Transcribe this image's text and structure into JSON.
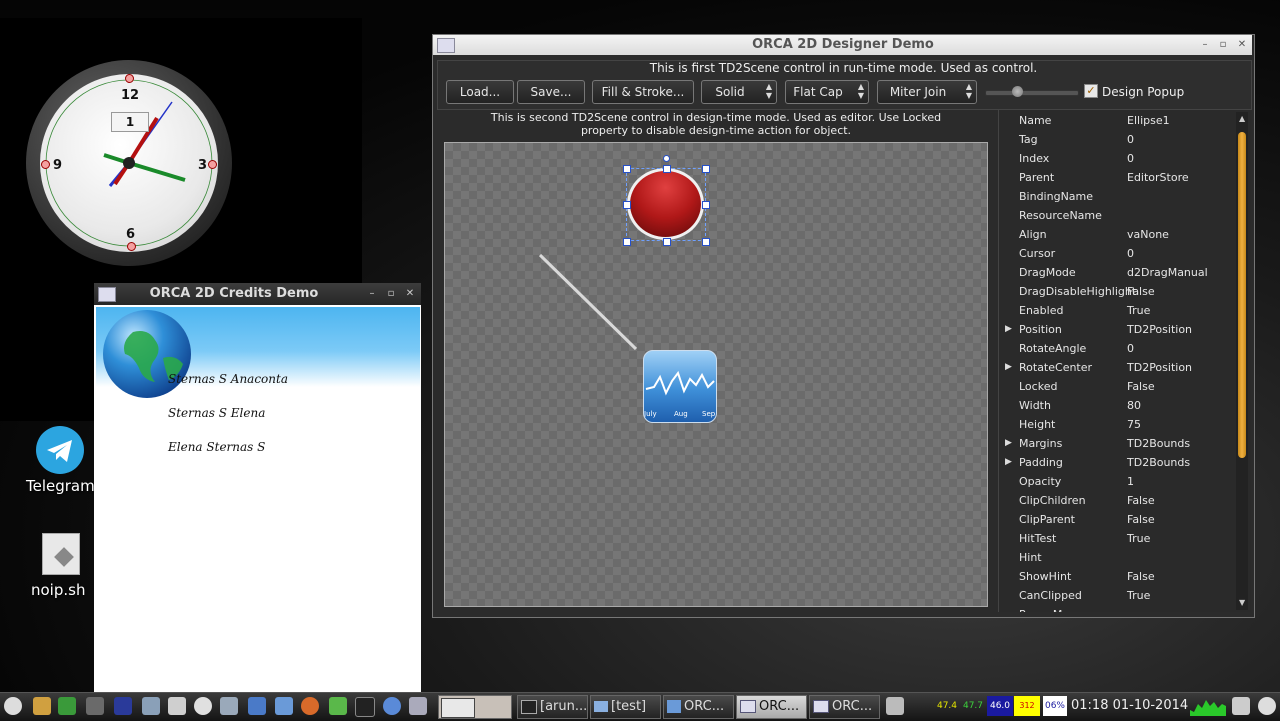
{
  "desktop": {
    "clock": {
      "numbers": [
        "12",
        "3",
        "6",
        "9"
      ],
      "date": "1"
    },
    "icons": [
      {
        "label": "Telegram",
        "icon": "telegram-icon"
      },
      {
        "label": "noip.sh",
        "icon": "script-file-icon"
      }
    ]
  },
  "credits_window": {
    "title": "ORCA 2D Credits Demo",
    "lines": [
      "Sternas S Anaconta",
      "Sternas S Elena",
      "Elena Sternas S"
    ]
  },
  "designer_window": {
    "title": "ORCA 2D Designer Demo",
    "runtime_caption": "This is first TD2Scene control in run-time mode. Used as control.",
    "toolbar": {
      "load": "Load...",
      "save": "Save...",
      "fill_stroke": "Fill & Stroke...",
      "dash": "Solid",
      "cap": "Flat Cap",
      "join": "Miter Join",
      "design_popup_label": "Design Popup",
      "design_popup_checked": true
    },
    "designtime_caption": "This is second TD2Scene control in design-time mode. Used as editor. Use Locked property to disable design-time action for object.",
    "chart_icon_labels": [
      "July",
      "Aug",
      "Sep"
    ],
    "properties": [
      {
        "name": "Name",
        "value": "Ellipse1"
      },
      {
        "name": "Tag",
        "value": "0"
      },
      {
        "name": "Index",
        "value": "0"
      },
      {
        "name": "Parent",
        "value": "EditorStore"
      },
      {
        "name": "BindingName",
        "value": ""
      },
      {
        "name": "ResourceName",
        "value": ""
      },
      {
        "name": "Align",
        "value": "vaNone"
      },
      {
        "name": "Cursor",
        "value": "0"
      },
      {
        "name": "DragMode",
        "value": "d2DragManual"
      },
      {
        "name": "DragDisableHighlight",
        "value": "False"
      },
      {
        "name": "Enabled",
        "value": "True"
      },
      {
        "name": "Position",
        "value": "TD2Position",
        "expandable": true
      },
      {
        "name": "RotateAngle",
        "value": "0"
      },
      {
        "name": "RotateCenter",
        "value": "TD2Position",
        "expandable": true
      },
      {
        "name": "Locked",
        "value": "False"
      },
      {
        "name": "Width",
        "value": "80"
      },
      {
        "name": "Height",
        "value": "75"
      },
      {
        "name": "Margins",
        "value": "TD2Bounds",
        "expandable": true
      },
      {
        "name": "Padding",
        "value": "TD2Bounds",
        "expandable": true
      },
      {
        "name": "Opacity",
        "value": "1"
      },
      {
        "name": "ClipChildren",
        "value": "False"
      },
      {
        "name": "ClipParent",
        "value": "False"
      },
      {
        "name": "HitTest",
        "value": "True"
      },
      {
        "name": "Hint",
        "value": ""
      },
      {
        "name": "ShowHint",
        "value": "False"
      },
      {
        "name": "CanClipped",
        "value": "True"
      },
      {
        "name": "PopupMenu",
        "value": ""
      }
    ]
  },
  "taskbar": {
    "tasks": [
      {
        "label": "[arun...",
        "icon": "terminal-icon"
      },
      {
        "label": "[test]",
        "icon": "folder-icon"
      },
      {
        "label": "ORC...",
        "icon": "app-icon"
      },
      {
        "label": "ORC...",
        "icon": "window-icon",
        "active": true
      },
      {
        "label": "ORC...",
        "icon": "window-icon"
      }
    ],
    "monitors": [
      "47.4",
      "47.7",
      "46.0",
      "312",
      "06%"
    ],
    "clock": "01:18 01-10-2014",
    "colors": {
      "cpu1": "#e6e600",
      "cpu2": "#3cd23c",
      "mon_blue": "#1a1aa0",
      "mon_yellow": "#ffff00",
      "mon_white": "#ffffff"
    }
  }
}
